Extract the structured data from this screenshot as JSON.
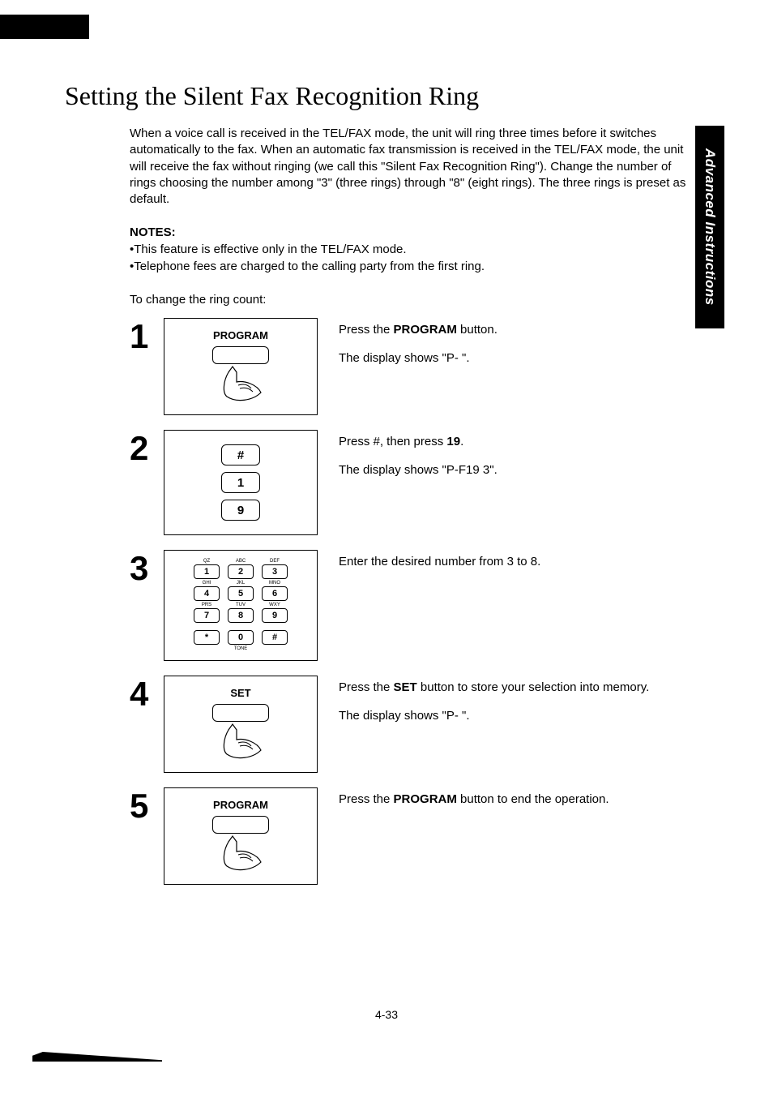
{
  "sidebar": {
    "label": "Advanced Instructions"
  },
  "title": "Setting the Silent Fax Recognition Ring",
  "intro": "When a voice call is received in the TEL/FAX mode, the unit will ring three times before it switches automatically to the fax. When an automatic fax transmission is received in the TEL/FAX mode, the unit will receive the fax without ringing (we call this \"Silent Fax Recognition Ring\"). Change the number of rings choosing the number among \"3\" (three rings) through \"8\" (eight rings). The three rings is preset as default.",
  "notes_heading": "NOTES:",
  "notes": [
    "This feature is effective only in the TEL/FAX mode.",
    "Telephone fees are charged to the calling party from the first ring."
  ],
  "leadin": "To change the ring count:",
  "steps": [
    {
      "num": "1",
      "diagram_label": "PROGRAM",
      "text_a": "Press the ",
      "bold_a": "PROGRAM",
      "text_b": " button.",
      "line2": "The display shows \"P-  \"."
    },
    {
      "num": "2",
      "keys": [
        "#",
        "1",
        "9"
      ],
      "text_a": "Press #, then press ",
      "bold_a": "19",
      "text_b": ".",
      "line2": "The display shows \"P-F19  3\"."
    },
    {
      "num": "3",
      "keypad": {
        "rows": [
          [
            {
              "t": "QZ",
              "n": "1"
            },
            {
              "t": "ABC",
              "n": "2"
            },
            {
              "t": "DEF",
              "n": "3"
            }
          ],
          [
            {
              "t": "GHI",
              "n": "4"
            },
            {
              "t": "JKL",
              "n": "5"
            },
            {
              "t": "MNO",
              "n": "6"
            }
          ],
          [
            {
              "t": "PRS",
              "n": "7"
            },
            {
              "t": "TUV",
              "n": "8"
            },
            {
              "t": "WXY",
              "n": "9"
            }
          ],
          [
            {
              "t": "",
              "n": "*"
            },
            {
              "t": "",
              "n": "0"
            },
            {
              "t": "",
              "n": "#"
            }
          ]
        ],
        "bottom_label": "TONE"
      },
      "text_a": "Enter the desired number from 3 to 8.",
      "bold_a": "",
      "text_b": "",
      "line2": ""
    },
    {
      "num": "4",
      "diagram_label": "SET",
      "text_a": "Press the ",
      "bold_a": "SET",
      "text_b": " button to store your selection into memory.",
      "line2": "The display shows \"P-  \"."
    },
    {
      "num": "5",
      "diagram_label": "PROGRAM",
      "text_a": "Press the ",
      "bold_a": "PROGRAM",
      "text_b": " button to end the operation.",
      "line2": ""
    }
  ],
  "page_number": "4-33"
}
